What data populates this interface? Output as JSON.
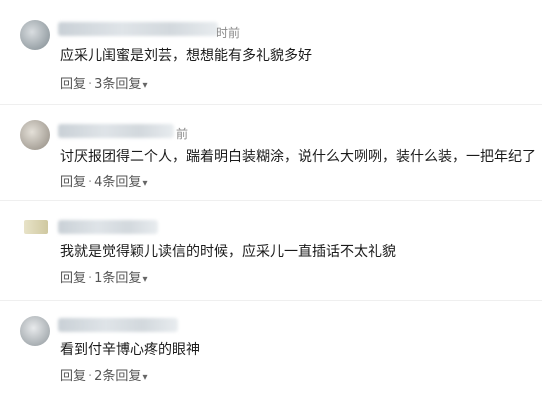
{
  "comments": [
    {
      "time": "前",
      "time_prefix": "时",
      "text": "应采儿闺蜜是刘芸，想想能有多礼貌多好",
      "reply": "回复",
      "replies": "3条回复"
    },
    {
      "time": "前",
      "time_prefix": "",
      "text": "讨厌报团得二个人，踹着明白装糊涂，说什么大咧咧，装什么装，一把年纪了",
      "reply": "回复",
      "replies": "4条回复"
    },
    {
      "time": "",
      "time_prefix": "",
      "text": "我就是觉得颖儿读信的时候，应采儿一直插话不太礼貌",
      "reply": "回复",
      "replies": "1条回复"
    },
    {
      "time": "",
      "time_prefix": "",
      "text": "看到付辛博心疼的眼神",
      "reply": "回复",
      "replies": "2条回复"
    }
  ],
  "separator": "·",
  "chevron_icon": "chevron-down-icon"
}
